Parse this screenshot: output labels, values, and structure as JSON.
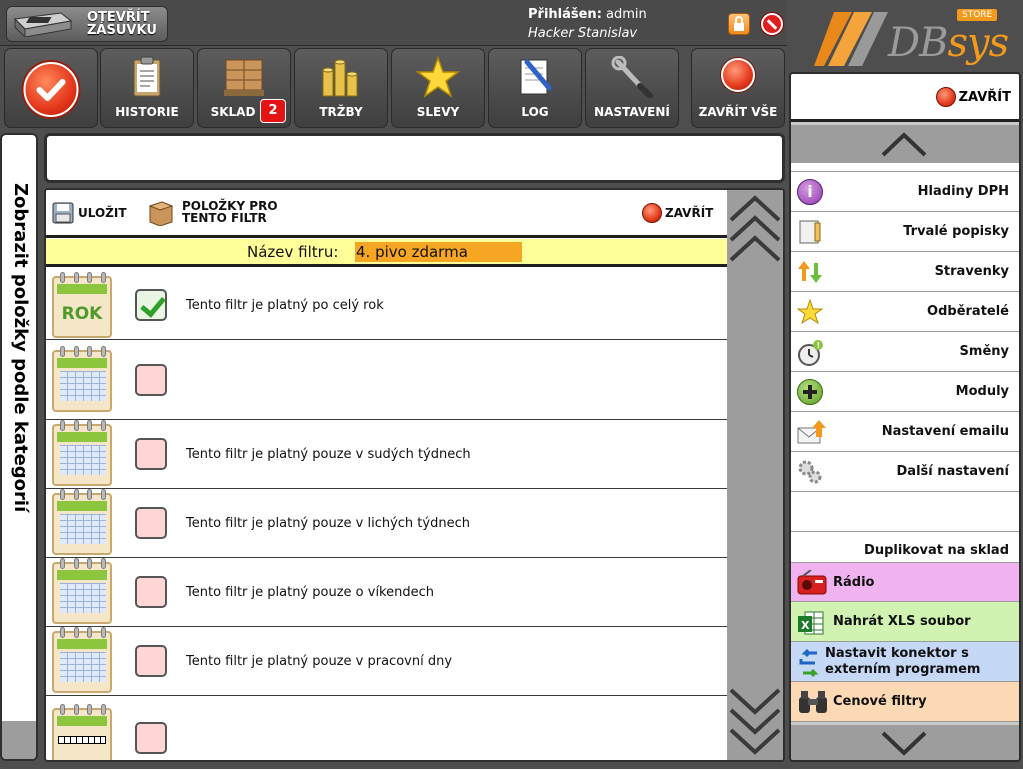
{
  "topbar": {
    "drawer_label": "OTEVŘÍT ZÁSUVKU",
    "login_label": "Přihlášen:",
    "login_user": "admin",
    "login_fullname": "Hacker Stanislav"
  },
  "logo": {
    "text_db": "DB",
    "text_sys": "sys",
    "store_badge": "STORE",
    "accent_color": "#f39a1d"
  },
  "toolbar": {
    "items": [
      {
        "label": "",
        "icon": "confirm-icon"
      },
      {
        "label": "HISTORIE",
        "icon": "history-clipboard-icon"
      },
      {
        "label": "SKLAD",
        "icon": "warehouse-boxes-icon",
        "badge": "2"
      },
      {
        "label": "TRŽBY",
        "icon": "coins-icon"
      },
      {
        "label": "SLEVY",
        "icon": "star-icon"
      },
      {
        "label": "LOG",
        "icon": "log-document-icon"
      },
      {
        "label": "NASTAVENÍ",
        "icon": "tools-icon"
      },
      {
        "label": "ZAVŘÍT VŠE",
        "icon": "close-all-icon"
      }
    ]
  },
  "left_tab": {
    "label": "Zobrazit položky podle kategorií"
  },
  "main": {
    "save_label": "ULOŽIT",
    "items_for_filter_label": "POLOŽKY PRO TENTO FILTR",
    "close_label": "ZAVŘÍT",
    "filter_name_label": "Název filtru:",
    "filter_name_value": "4. pivo zdarma",
    "rows": [
      {
        "icon": "calendar-year-icon",
        "icon_text": "ROK",
        "checked": true,
        "text": "Tento filtr je platný po celý rok"
      },
      {
        "icon": "calendar-icon",
        "checked": false,
        "text": ""
      },
      {
        "icon": "calendar-icon",
        "checked": false,
        "text": "Tento filtr je platný pouze v sudých týdnech"
      },
      {
        "icon": "calendar-icon",
        "checked": false,
        "text": "Tento filtr je platný pouze v lichých týdnech"
      },
      {
        "icon": "calendar-icon",
        "checked": false,
        "text": "Tento filtr je platný pouze o víkendech"
      },
      {
        "icon": "calendar-icon",
        "checked": false,
        "text": "Tento filtr je platný pouze v pracovní dny"
      },
      {
        "icon": "calendar-time-icon",
        "checked": false,
        "text": ""
      }
    ]
  },
  "right_panel": {
    "close_label": "ZAVŘÍT",
    "menu": [
      {
        "label": "Hladiny DPH",
        "icon": "info-icon"
      },
      {
        "label": "Trvalé popisky",
        "icon": "note-icon"
      },
      {
        "label": "Stravenky",
        "icon": "arrows-icon"
      },
      {
        "label": "Odběratelé",
        "icon": "star-icon"
      },
      {
        "label": "Směny",
        "icon": "clock-icon"
      },
      {
        "label": "Moduly",
        "icon": "plus-icon"
      },
      {
        "label": "Nastavení emailu",
        "icon": "email-icon"
      },
      {
        "label": "Další nastavení",
        "icon": "gears-icon"
      },
      {
        "label": "",
        "icon": ""
      },
      {
        "label": "Duplikovat na sklad",
        "icon": ""
      },
      {
        "label": "Rádio",
        "icon": "radio-icon",
        "bg": "#f0b3f0"
      },
      {
        "label": "Nahrát XLS soubor",
        "icon": "excel-icon",
        "bg": "#d0f3b1"
      },
      {
        "label": "Nastavit konektor s externím programem",
        "icon": "connector-arrows-icon",
        "bg": "#c5d8f5"
      },
      {
        "label": "Cenové filtry",
        "icon": "binoculars-icon",
        "bg": "#fcd9b5"
      }
    ]
  }
}
